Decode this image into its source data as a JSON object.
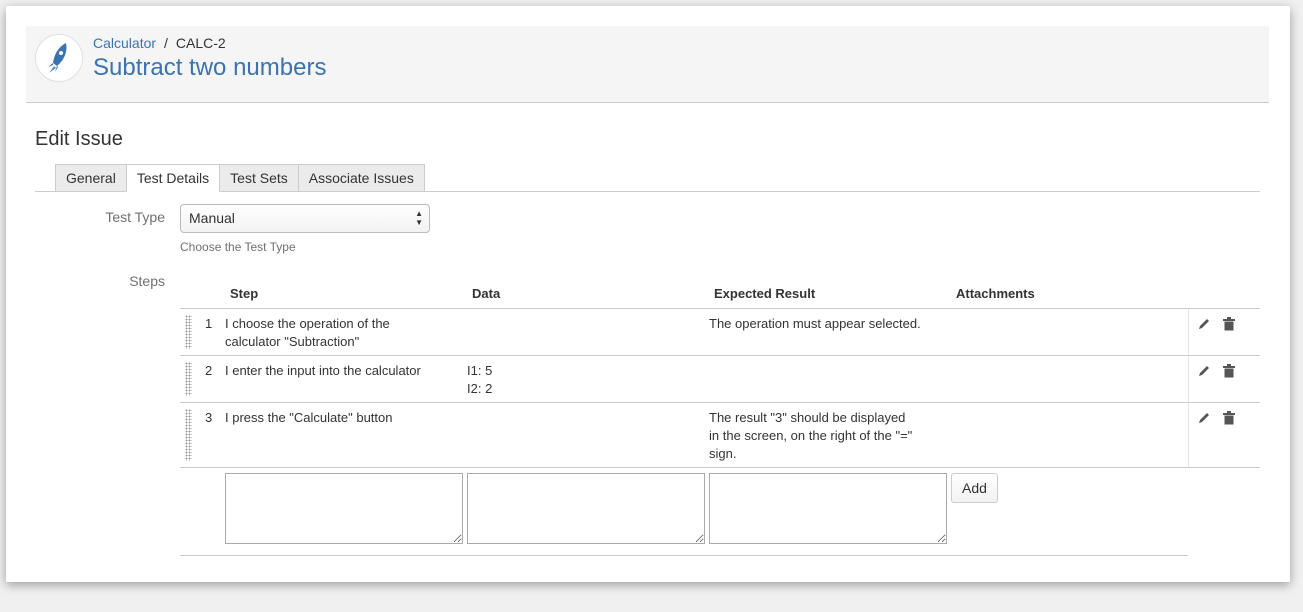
{
  "header": {
    "project_link": "Calculator",
    "separator": "/",
    "issue_key": "CALC-2",
    "title": "Subtract two numbers"
  },
  "edit_title": "Edit Issue",
  "tabs": [
    {
      "label": "General",
      "active": false
    },
    {
      "label": "Test Details",
      "active": true
    },
    {
      "label": "Test Sets",
      "active": false
    },
    {
      "label": "Associate Issues",
      "active": false
    }
  ],
  "test_type": {
    "label": "Test Type",
    "value": "Manual",
    "help": "Choose the Test Type"
  },
  "steps": {
    "label": "Steps",
    "columns": {
      "step": "Step",
      "data": "Data",
      "expected": "Expected Result",
      "attachments": "Attachments"
    },
    "rows": [
      {
        "num": "1",
        "step": "I choose the operation of the calculator \"Subtraction\"",
        "data": "",
        "expected": "The operation must appear selected."
      },
      {
        "num": "2",
        "step": "I enter the input into the calculator",
        "data": "I1: 5\nI2: 2",
        "expected": ""
      },
      {
        "num": "3",
        "step": "I press the \"Calculate\" button",
        "data": "",
        "expected": "The result \"3\" should be displayed in the screen, on the right of the \"=\" sign."
      }
    ],
    "add_label": "Add"
  },
  "colors": {
    "link": "#3b73af",
    "border": "#cccccc",
    "muted": "#707070"
  },
  "icons": [
    "rocket-icon",
    "pencil-icon",
    "trash-icon",
    "drag-handle-icon",
    "updown-arrows-icon"
  ]
}
